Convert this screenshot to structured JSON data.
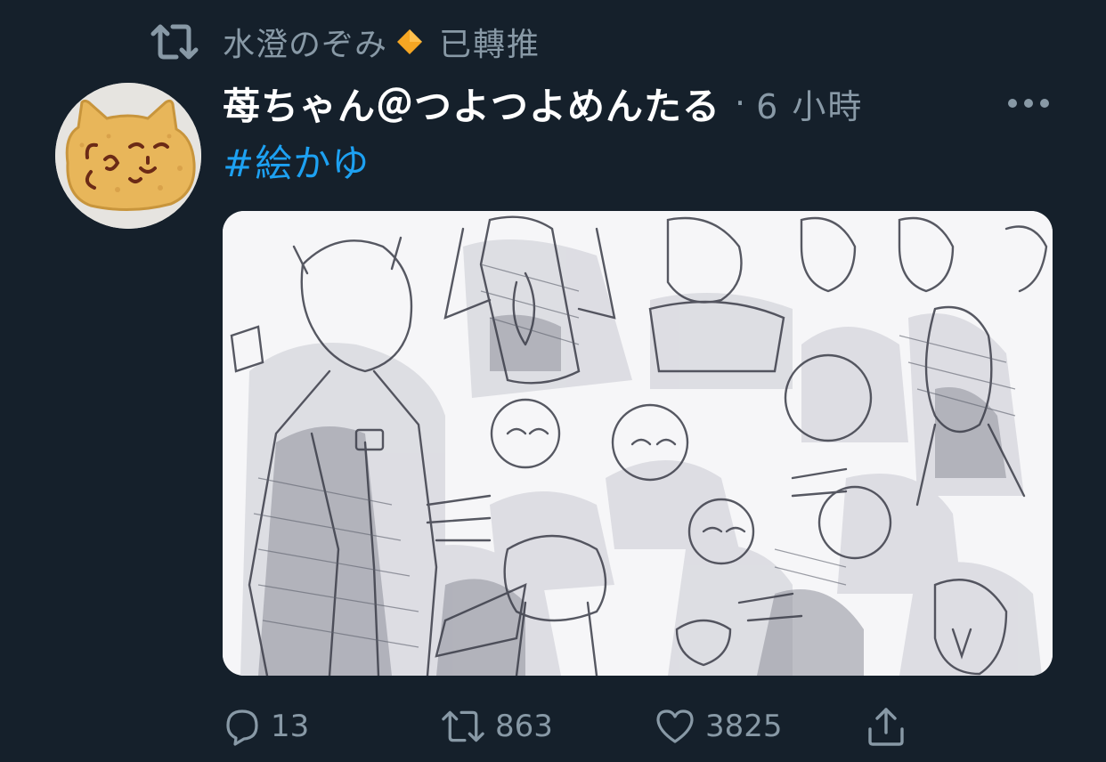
{
  "retweet_context": {
    "retweeter_name": "水澄のぞみ",
    "suffix": "已轉推",
    "icon": "retweet-icon",
    "badge_icon": "orange-diamond-icon",
    "badge_color": "#f5a623"
  },
  "tweet": {
    "author_display_name": "苺ちゃん＠つよつよめんたる",
    "separator": "·",
    "timestamp": "6 小時",
    "text": "#絵かゆ",
    "hashtag_color": "#1da1f2",
    "more_icon": "more-dots-icon",
    "media_alt": "monochrome sketch collage illustration"
  },
  "actions": {
    "reply": {
      "icon": "reply-icon",
      "count": "13"
    },
    "retweet": {
      "icon": "retweet-icon",
      "count": "863"
    },
    "like": {
      "icon": "heart-icon",
      "count": "3825"
    },
    "share": {
      "icon": "share-icon"
    }
  },
  "colors": {
    "background": "#15202b",
    "secondary_text": "#8899a6",
    "primary_text": "#ffffff",
    "link": "#1da1f2"
  }
}
